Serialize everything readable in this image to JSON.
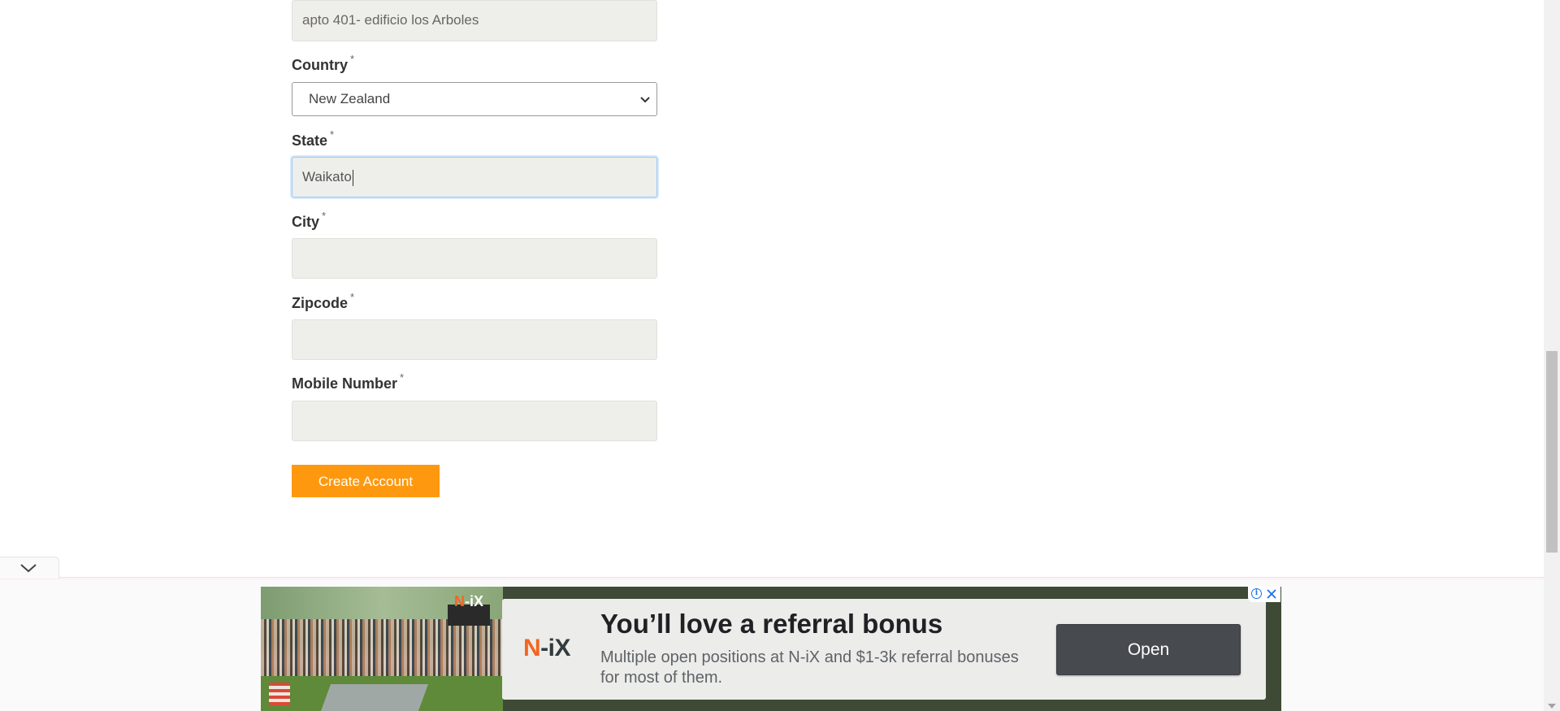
{
  "form": {
    "address2_value": "apto 401- edificio los Arboles",
    "country": {
      "label": "Country",
      "required_mark": "*",
      "selected": "New Zealand"
    },
    "state": {
      "label": "State",
      "required_mark": "*",
      "value": "Waikato"
    },
    "city": {
      "label": "City",
      "required_mark": "*",
      "value": ""
    },
    "zipcode": {
      "label": "Zipcode",
      "required_mark": "*",
      "value": ""
    },
    "mobile": {
      "label": "Mobile Number",
      "required_mark": "*",
      "value": ""
    },
    "submit_label": "Create Account"
  },
  "ad": {
    "photo_logo": {
      "n": "N",
      "rest": "-iX"
    },
    "brand": {
      "n": "N",
      "rest": "-iX"
    },
    "headline": "You’ll love a referral bonus",
    "body": "Multiple open positions at N-iX and $1-3k referral bonuses for most of them.",
    "cta": "Open",
    "info_glyph": "i",
    "icons": [
      "ad-info-icon",
      "ad-close-icon",
      "chevron-down-icon"
    ]
  },
  "colors": {
    "accent_button": "#fe980f",
    "input_bg": "#eeeeea",
    "brand_orange": "#f26522",
    "ad_cta": "#474b4f"
  }
}
